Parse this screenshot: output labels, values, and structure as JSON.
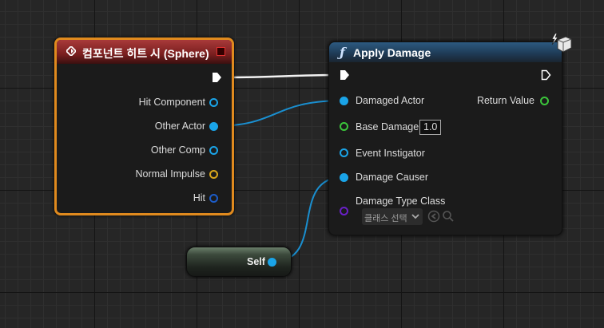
{
  "event_node": {
    "title": "컴포넌트 히트 시 (Sphere)",
    "outputs": [
      {
        "label": "Hit Component"
      },
      {
        "label": "Other Actor"
      },
      {
        "label": "Other Comp"
      },
      {
        "label": "Normal Impulse"
      },
      {
        "label": "Hit"
      }
    ]
  },
  "function_node": {
    "title": "Apply Damage",
    "inputs": [
      {
        "label": "Damaged Actor"
      },
      {
        "label": "Base Damage",
        "value": "1.0"
      },
      {
        "label": "Event Instigator"
      },
      {
        "label": "Damage Causer"
      },
      {
        "label": "Damage Type Class",
        "placeholder": "클래스 선택"
      }
    ],
    "outputs": [
      {
        "label": "Return Value"
      }
    ]
  },
  "self_node": {
    "label": "Self"
  },
  "colors": {
    "object_pin": "#1aa4e8",
    "float_pin": "#3bc53b",
    "struct_pin": "#d8a61c",
    "hit_pin": "#1c5cc8",
    "class_pin": "#6a20c8",
    "event_border": "#e08a1e",
    "exec_wire": "#ffffff"
  }
}
